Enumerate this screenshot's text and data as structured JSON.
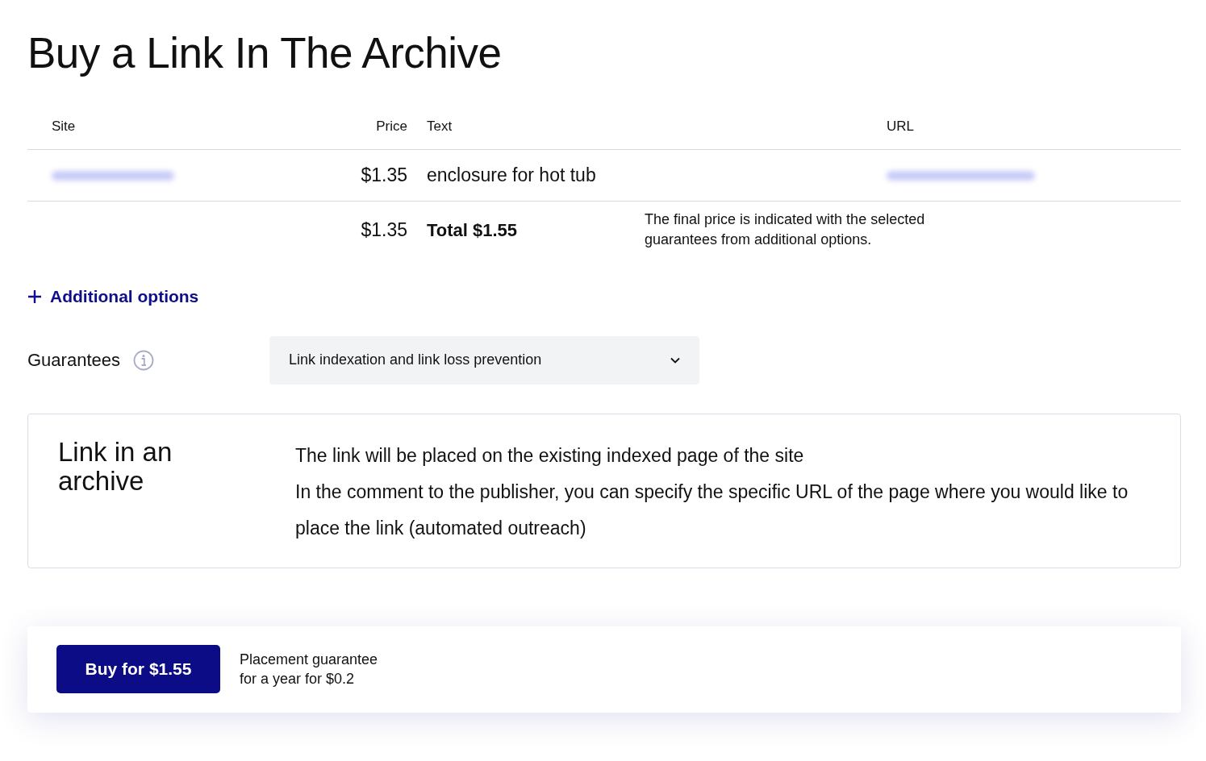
{
  "title": "Buy a Link In The Archive",
  "table": {
    "columns": [
      "Site",
      "Price",
      "Text",
      "URL"
    ],
    "rows": [
      {
        "site_blurred": true,
        "price": "$1.35",
        "text": "enclosure for hot tub",
        "url_blurred": true
      }
    ],
    "total_row": {
      "price": "$1.35",
      "total": "Total $1.55",
      "note": "The final price is indicated with the selected guarantees from additional options."
    }
  },
  "additional_options": {
    "label": "Additional options"
  },
  "guarantees": {
    "label": "Guarantees",
    "value": "Link indexation and link loss prevention"
  },
  "option_card": {
    "title": "Link in an archive",
    "paragraphs": [
      "The link will be placed on the existing indexed page of the site",
      "In the comment to the publisher, you can specify the specific URL of the page where you would like to place the link (automated outreach)"
    ]
  },
  "purchase_bar": {
    "button": "Buy for $1.55",
    "note_lines": [
      "Placement guarantee",
      "for a year for $0.2"
    ]
  }
}
